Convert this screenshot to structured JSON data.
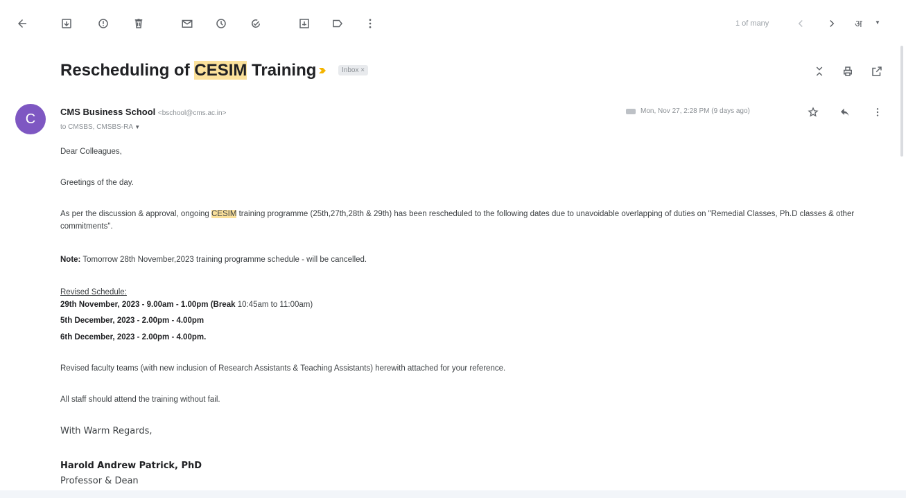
{
  "toolbar": {
    "back_icon": "arrow-left-icon",
    "icons": [
      "archive-icon",
      "report-spam-icon",
      "delete-icon",
      "mark-unread-icon",
      "snooze-icon",
      "add-to-tasks-icon",
      "move-to-icon",
      "labels-icon",
      "more-icon"
    ],
    "pagination": "1 of many",
    "input_tools": "अ"
  },
  "subject": {
    "before": "Rescheduling of ",
    "highlight": "CESIM",
    "after": " Training",
    "label": "Inbox ×"
  },
  "message": {
    "avatar_letter": "C",
    "avatar_color": "#7e57c2",
    "sender_name": "CMS Business School",
    "sender_email": "<bschool@cms.ac.in>",
    "recipients": "to CMSBS, CMSBS-RA",
    "date": "Mon, Nov 27, 2:28 PM (9 days ago)"
  },
  "body": {
    "greeting": "Dear Colleagues,",
    "greetings_day": "Greetings of the day.",
    "para1_before": "As per the discussion & approval, ongoing ",
    "para1_highlight": "CESIM",
    "para1_after": " training programme (25th,27th,28th & 29th) has been rescheduled to the following dates due to unavoidable overlapping of duties on \"Remedial Classes, Ph.D classes & other commitments\".",
    "note_label": "Note:",
    "note_text": " Tomorrow 28th November,2023 training programme schedule - will be cancelled.",
    "revised_heading": "Revised Schedule:",
    "schedule1_bold": "29th November, 2023 - 9.00am - 1.00pm (Break",
    "schedule1_rest": " 10:45am to 11:00am)",
    "schedule2": "5th December, 2023 - 2.00pm - 4.00pm",
    "schedule3": "6th December, 2023 - 2.00pm - 4.00pm.",
    "faculty_teams": "Revised faculty teams (with new inclusion of Research Assistants & Teaching Assistants) herewith attached for your reference.",
    "attend": "All staff should attend the training without fail.",
    "regards": "With Warm Regards,",
    "signature_name": "Harold Andrew Patrick, PhD",
    "signature_title": "Professor & Dean"
  },
  "colors": {
    "highlight": "#fbe19b",
    "importance": "#f4b400"
  }
}
